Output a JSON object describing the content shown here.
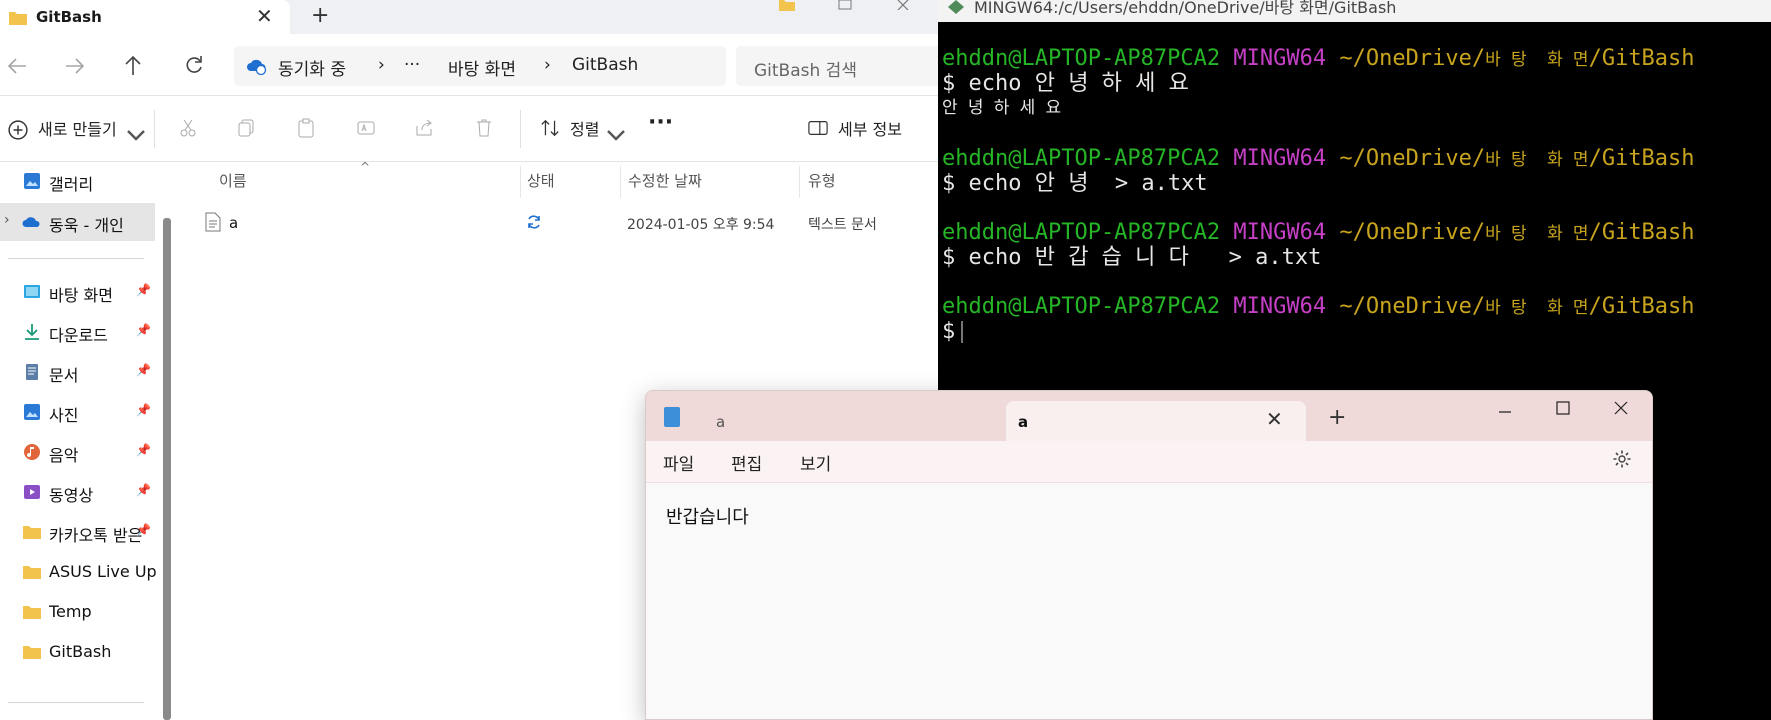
{
  "explorer": {
    "tab_title": "GitBash",
    "tab_close": "✕",
    "new_tab": "+",
    "address": {
      "sync_status": "동기화 중",
      "ellipsis": "···",
      "crumb1": "바탕 화면",
      "crumb2": "GitBash",
      "sep": "›"
    },
    "search_placeholder": "GitBash 검색",
    "toolbar": {
      "new_label": "새로 만들기",
      "sort_label": "정렬",
      "more": "···",
      "details_label": "세부 정보"
    },
    "sidebar": {
      "gallery": "갤러리",
      "onedrive": "동욱 - 개인",
      "items": [
        {
          "label": "바탕 화면",
          "pinned": true
        },
        {
          "label": "다운로드",
          "pinned": true
        },
        {
          "label": "문서",
          "pinned": true
        },
        {
          "label": "사진",
          "pinned": true
        },
        {
          "label": "음악",
          "pinned": true
        },
        {
          "label": "동영상",
          "pinned": true
        },
        {
          "label": "카카오톡 받은",
          "pinned": true
        },
        {
          "label": "ASUS Live Upda",
          "pinned": false
        },
        {
          "label": "Temp",
          "pinned": false
        },
        {
          "label": "GitBash",
          "pinned": false
        }
      ]
    },
    "columns": {
      "name": "이름",
      "status": "상태",
      "modified": "수정한 날짜",
      "type": "유형"
    },
    "files": [
      {
        "name": "a",
        "modified": "2024-01-05 오후 9:54",
        "type": "텍스트 문서"
      }
    ]
  },
  "terminal": {
    "title": "MINGW64:/c/Users/ehddn/OneDrive/바탕 화면/GitBash",
    "user": "ehddn@LAPTOP-AP87PCA2",
    "env": "MINGW64",
    "path_a": "~/OneDrive/",
    "path_b": "바 탕  화 면",
    "path_c": "/GitBash",
    "cmd1": "$ echo 안 녕 하 세 요",
    "out1": "안 녕 하 세 요",
    "cmd2": "$ echo 안 녕  > a.txt",
    "cmd3": "$ echo 반 갑 습 니 다   > a.txt",
    "prompt": "$"
  },
  "notepad": {
    "tab_inactive": "a",
    "tab_active": "a",
    "tab_close": "✕",
    "new_tab": "+",
    "menu_file": "파일",
    "menu_edit": "편집",
    "menu_view": "보기",
    "content": "반갑습니다"
  },
  "colors": {
    "terminal_green": "#26b526",
    "terminal_magenta": "#c640c6",
    "terminal_yellow": "#c8a41e",
    "notepad_title_bg": "#f0d9d9"
  }
}
